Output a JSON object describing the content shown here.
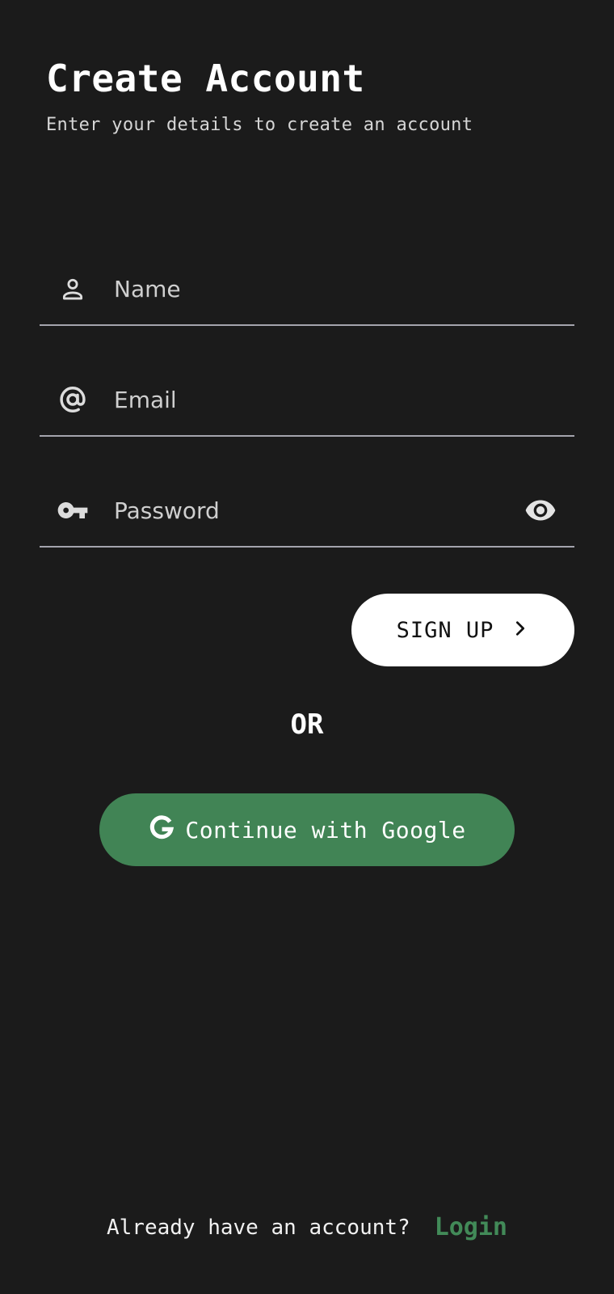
{
  "header": {
    "title": "Create Account",
    "subtitle": "Enter your details to create an account"
  },
  "form": {
    "name": {
      "placeholder": "Name",
      "value": "",
      "icon": "person-icon"
    },
    "email": {
      "placeholder": "Email",
      "value": "",
      "icon": "at-sign-icon"
    },
    "password": {
      "placeholder": "Password",
      "value": "",
      "icon": "key-icon",
      "toggle_icon": "eye-icon"
    }
  },
  "actions": {
    "signup_label": "SIGN UP",
    "signup_icon": "chevron-right-icon",
    "divider_label": "OR",
    "google_label": "Continue with Google",
    "google_icon": "google-icon"
  },
  "footer": {
    "prompt": "Already have an account?",
    "login_label": "Login"
  },
  "colors": {
    "background": "#1b1b1b",
    "accent_green": "#418455",
    "link_green": "#428a58",
    "divider": "#a4a4ad"
  }
}
